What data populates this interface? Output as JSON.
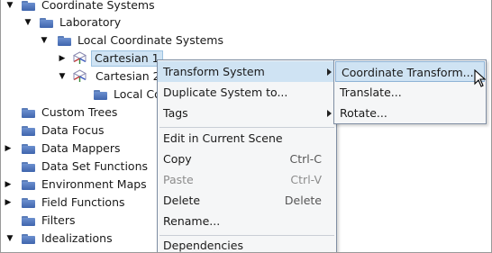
{
  "tree": {
    "items": [
      {
        "label": "Coordinate Systems",
        "icon": "folder-icon"
      },
      {
        "label": "Laboratory",
        "icon": "folder-icon"
      },
      {
        "label": "Local Coordinate Systems",
        "icon": "folder-icon"
      },
      {
        "label": "Cartesian 1",
        "icon": "cartesian-cube-icon"
      },
      {
        "label": "Cartesian 2",
        "icon": "cartesian-cube-icon"
      },
      {
        "label": "Local Coordinate Systems",
        "icon": "folder-icon"
      },
      {
        "label": "Custom Trees",
        "icon": "folder-icon"
      },
      {
        "label": "Data Focus",
        "icon": "folder-icon"
      },
      {
        "label": "Data Mappers",
        "icon": "folder-icon"
      },
      {
        "label": "Data Set Functions",
        "icon": "folder-icon"
      },
      {
        "label": "Environment Maps",
        "icon": "folder-icon"
      },
      {
        "label": "Field Functions",
        "icon": "folder-icon"
      },
      {
        "label": "Filters",
        "icon": "folder-icon"
      },
      {
        "label": "Idealizations",
        "icon": "folder-icon"
      }
    ]
  },
  "context_menu": {
    "items": [
      {
        "label": "Transform System",
        "submenu": true
      },
      {
        "label": "Duplicate System to...",
        "submenu": false
      },
      {
        "label": "Tags",
        "submenu": true
      },
      {
        "label": "Edit in Current Scene"
      },
      {
        "label": "Copy",
        "shortcut": "Ctrl-C"
      },
      {
        "label": "Paste",
        "shortcut": "Ctrl-V",
        "disabled": true
      },
      {
        "label": "Delete",
        "shortcut": "Delete"
      },
      {
        "label": "Rename..."
      },
      {
        "label": "Dependencies"
      }
    ]
  },
  "submenu": {
    "items": [
      {
        "label": "Coordinate Transform..."
      },
      {
        "label": "Translate..."
      },
      {
        "label": "Rotate..."
      }
    ]
  },
  "colors": {
    "highlight": "#cfe3f3",
    "folder": "#4a70b5"
  }
}
